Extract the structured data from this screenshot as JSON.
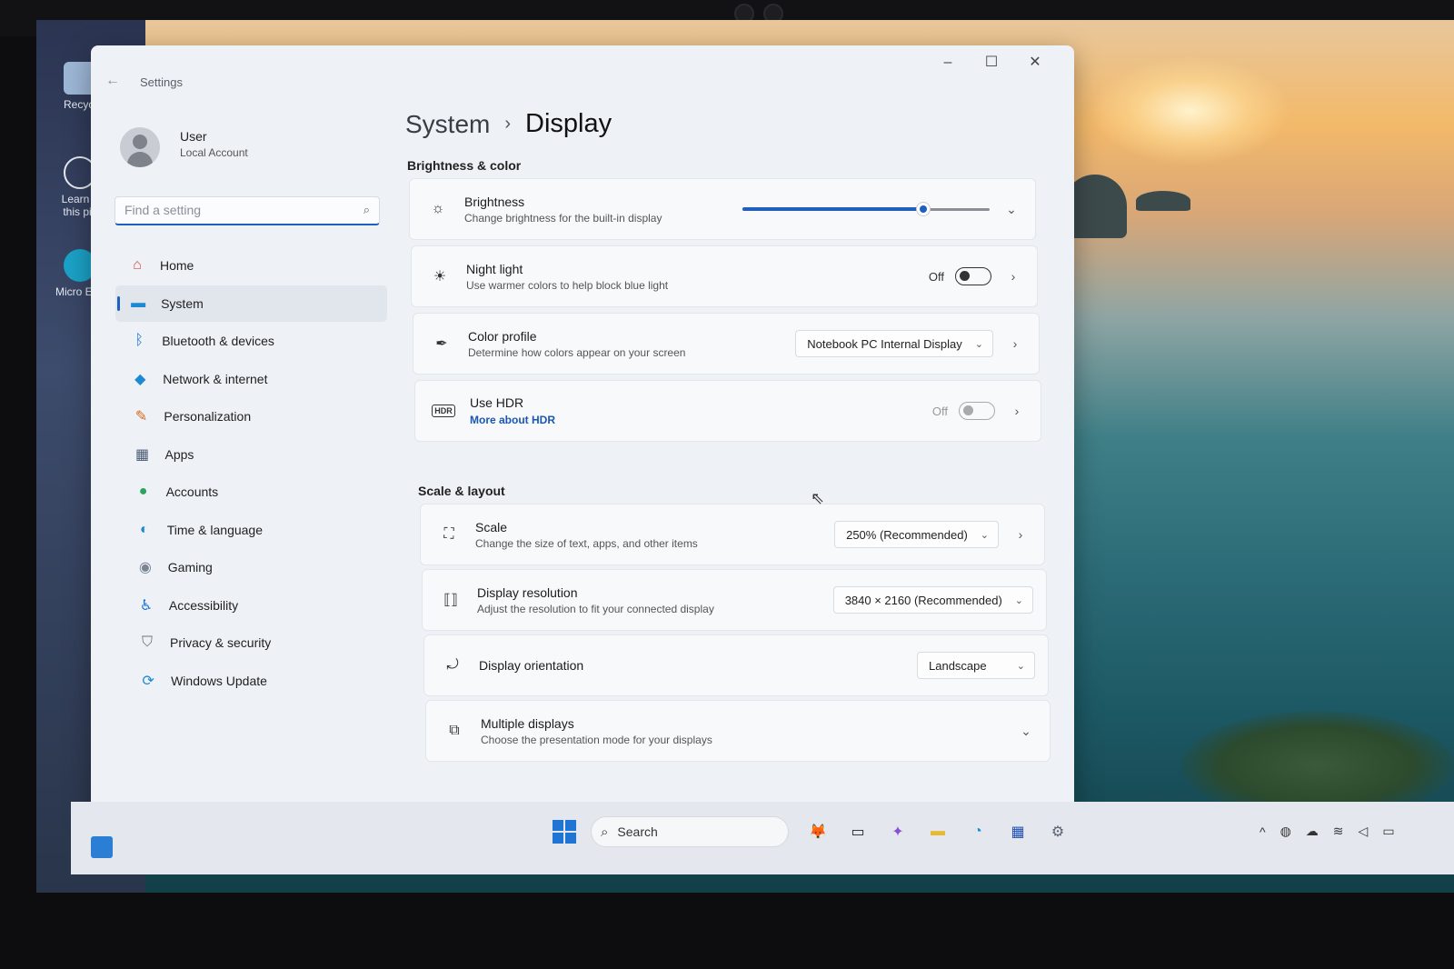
{
  "window": {
    "app_title": "Settings",
    "minimize": "–",
    "maximize": "☐",
    "close": "✕",
    "back": "←"
  },
  "user": {
    "name": "User",
    "account_type": "Local Account"
  },
  "search": {
    "placeholder": "Find a setting",
    "value": ""
  },
  "nav": {
    "items": [
      {
        "label": "Home",
        "icon": "home-icon",
        "glyph": "⌂",
        "color": "#e0453a"
      },
      {
        "label": "System",
        "icon": "system-icon",
        "glyph": "▬",
        "color": "#1b8ad3",
        "active": true
      },
      {
        "label": "Bluetooth & devices",
        "icon": "bluetooth-icon",
        "glyph": "ᛒ",
        "color": "#1f74d4"
      },
      {
        "label": "Network & internet",
        "icon": "network-icon",
        "glyph": "◆",
        "color": "#1b8ad3"
      },
      {
        "label": "Personalization",
        "icon": "brush-icon",
        "glyph": "✎",
        "color": "#d46a1f"
      },
      {
        "label": "Apps",
        "icon": "apps-icon",
        "glyph": "▦",
        "color": "#4a5b76"
      },
      {
        "label": "Accounts",
        "icon": "accounts-icon",
        "glyph": "●",
        "color": "#2aa55a"
      },
      {
        "label": "Time & language",
        "icon": "globe-clock-icon",
        "glyph": "◐",
        "color": "#1b8ad3"
      },
      {
        "label": "Gaming",
        "icon": "gamepad-icon",
        "glyph": "◉",
        "color": "#7a8494"
      },
      {
        "label": "Accessibility",
        "icon": "accessibility-icon",
        "glyph": "♿",
        "color": "#1f74d4"
      },
      {
        "label": "Privacy & security",
        "icon": "shield-icon",
        "glyph": "⛉",
        "color": "#6b7280"
      },
      {
        "label": "Windows Update",
        "icon": "update-icon",
        "glyph": "⟳",
        "color": "#1b8ad3"
      }
    ]
  },
  "breadcrumb": {
    "parent": "System",
    "separator": "›",
    "current": "Display"
  },
  "sections": {
    "brightness_color": "Brightness & color",
    "scale_layout": "Scale & layout"
  },
  "brightness": {
    "title": "Brightness",
    "description": "Change brightness for the built-in display",
    "level": 0.73
  },
  "night_light": {
    "title": "Night light",
    "description": "Use warmer colors to help block blue light",
    "state": "Off"
  },
  "color_profile": {
    "title": "Color profile",
    "description": "Determine how colors appear on your screen",
    "selected": "Notebook PC Internal Display"
  },
  "hdr": {
    "title": "Use HDR",
    "link": "More about HDR",
    "state": "Off"
  },
  "scale": {
    "title": "Scale",
    "description": "Change the size of text, apps, and other items",
    "selected": "250% (Recommended)"
  },
  "resolution": {
    "title": "Display resolution",
    "description": "Adjust the resolution to fit your connected display",
    "selected": "3840 × 2160 (Recommended)"
  },
  "orientation": {
    "title": "Display orientation",
    "selected": "Landscape"
  },
  "multiple_displays": {
    "title": "Multiple displays",
    "description": "Choose the presentation mode for your displays"
  },
  "desktop": {
    "icons": [
      {
        "label": "Recycl",
        "icon": "recycle-bin-icon"
      },
      {
        "label": "Learn a this pic",
        "icon": "learn-icon"
      },
      {
        "label": "Micro Edg",
        "icon": "edge-shortcut-icon"
      }
    ]
  },
  "taskbar": {
    "search_label": "Search",
    "apps": [
      {
        "icon": "fox-app-icon",
        "color": "#d46a1f",
        "glyph": "🦊"
      },
      {
        "icon": "task-view-icon",
        "color": "#222",
        "glyph": "▭"
      },
      {
        "icon": "copilot-icon",
        "color": "#8a4fd4",
        "glyph": "✦"
      },
      {
        "icon": "file-explorer-icon",
        "color": "#e8b830",
        "glyph": "▬"
      },
      {
        "icon": "edge-icon",
        "color": "#1b8ad3",
        "glyph": "◔"
      },
      {
        "icon": "store-icon",
        "color": "#1f4fb4",
        "glyph": "▦"
      },
      {
        "icon": "settings-gear-icon",
        "color": "#5a6270",
        "glyph": "⚙"
      }
    ],
    "tray": [
      {
        "icon": "chevron-up-icon",
        "glyph": "^"
      },
      {
        "icon": "security-icon",
        "glyph": "◍"
      },
      {
        "icon": "cloud-icon",
        "glyph": "☁"
      },
      {
        "icon": "wifi-icon",
        "glyph": "≋"
      },
      {
        "icon": "volume-icon",
        "glyph": "◁"
      },
      {
        "icon": "battery-icon",
        "glyph": "▭"
      }
    ]
  },
  "colors": {
    "accent": "#1f5fbf",
    "window_bg": "#eef1f6",
    "card_bg": "#f8f9fb"
  }
}
